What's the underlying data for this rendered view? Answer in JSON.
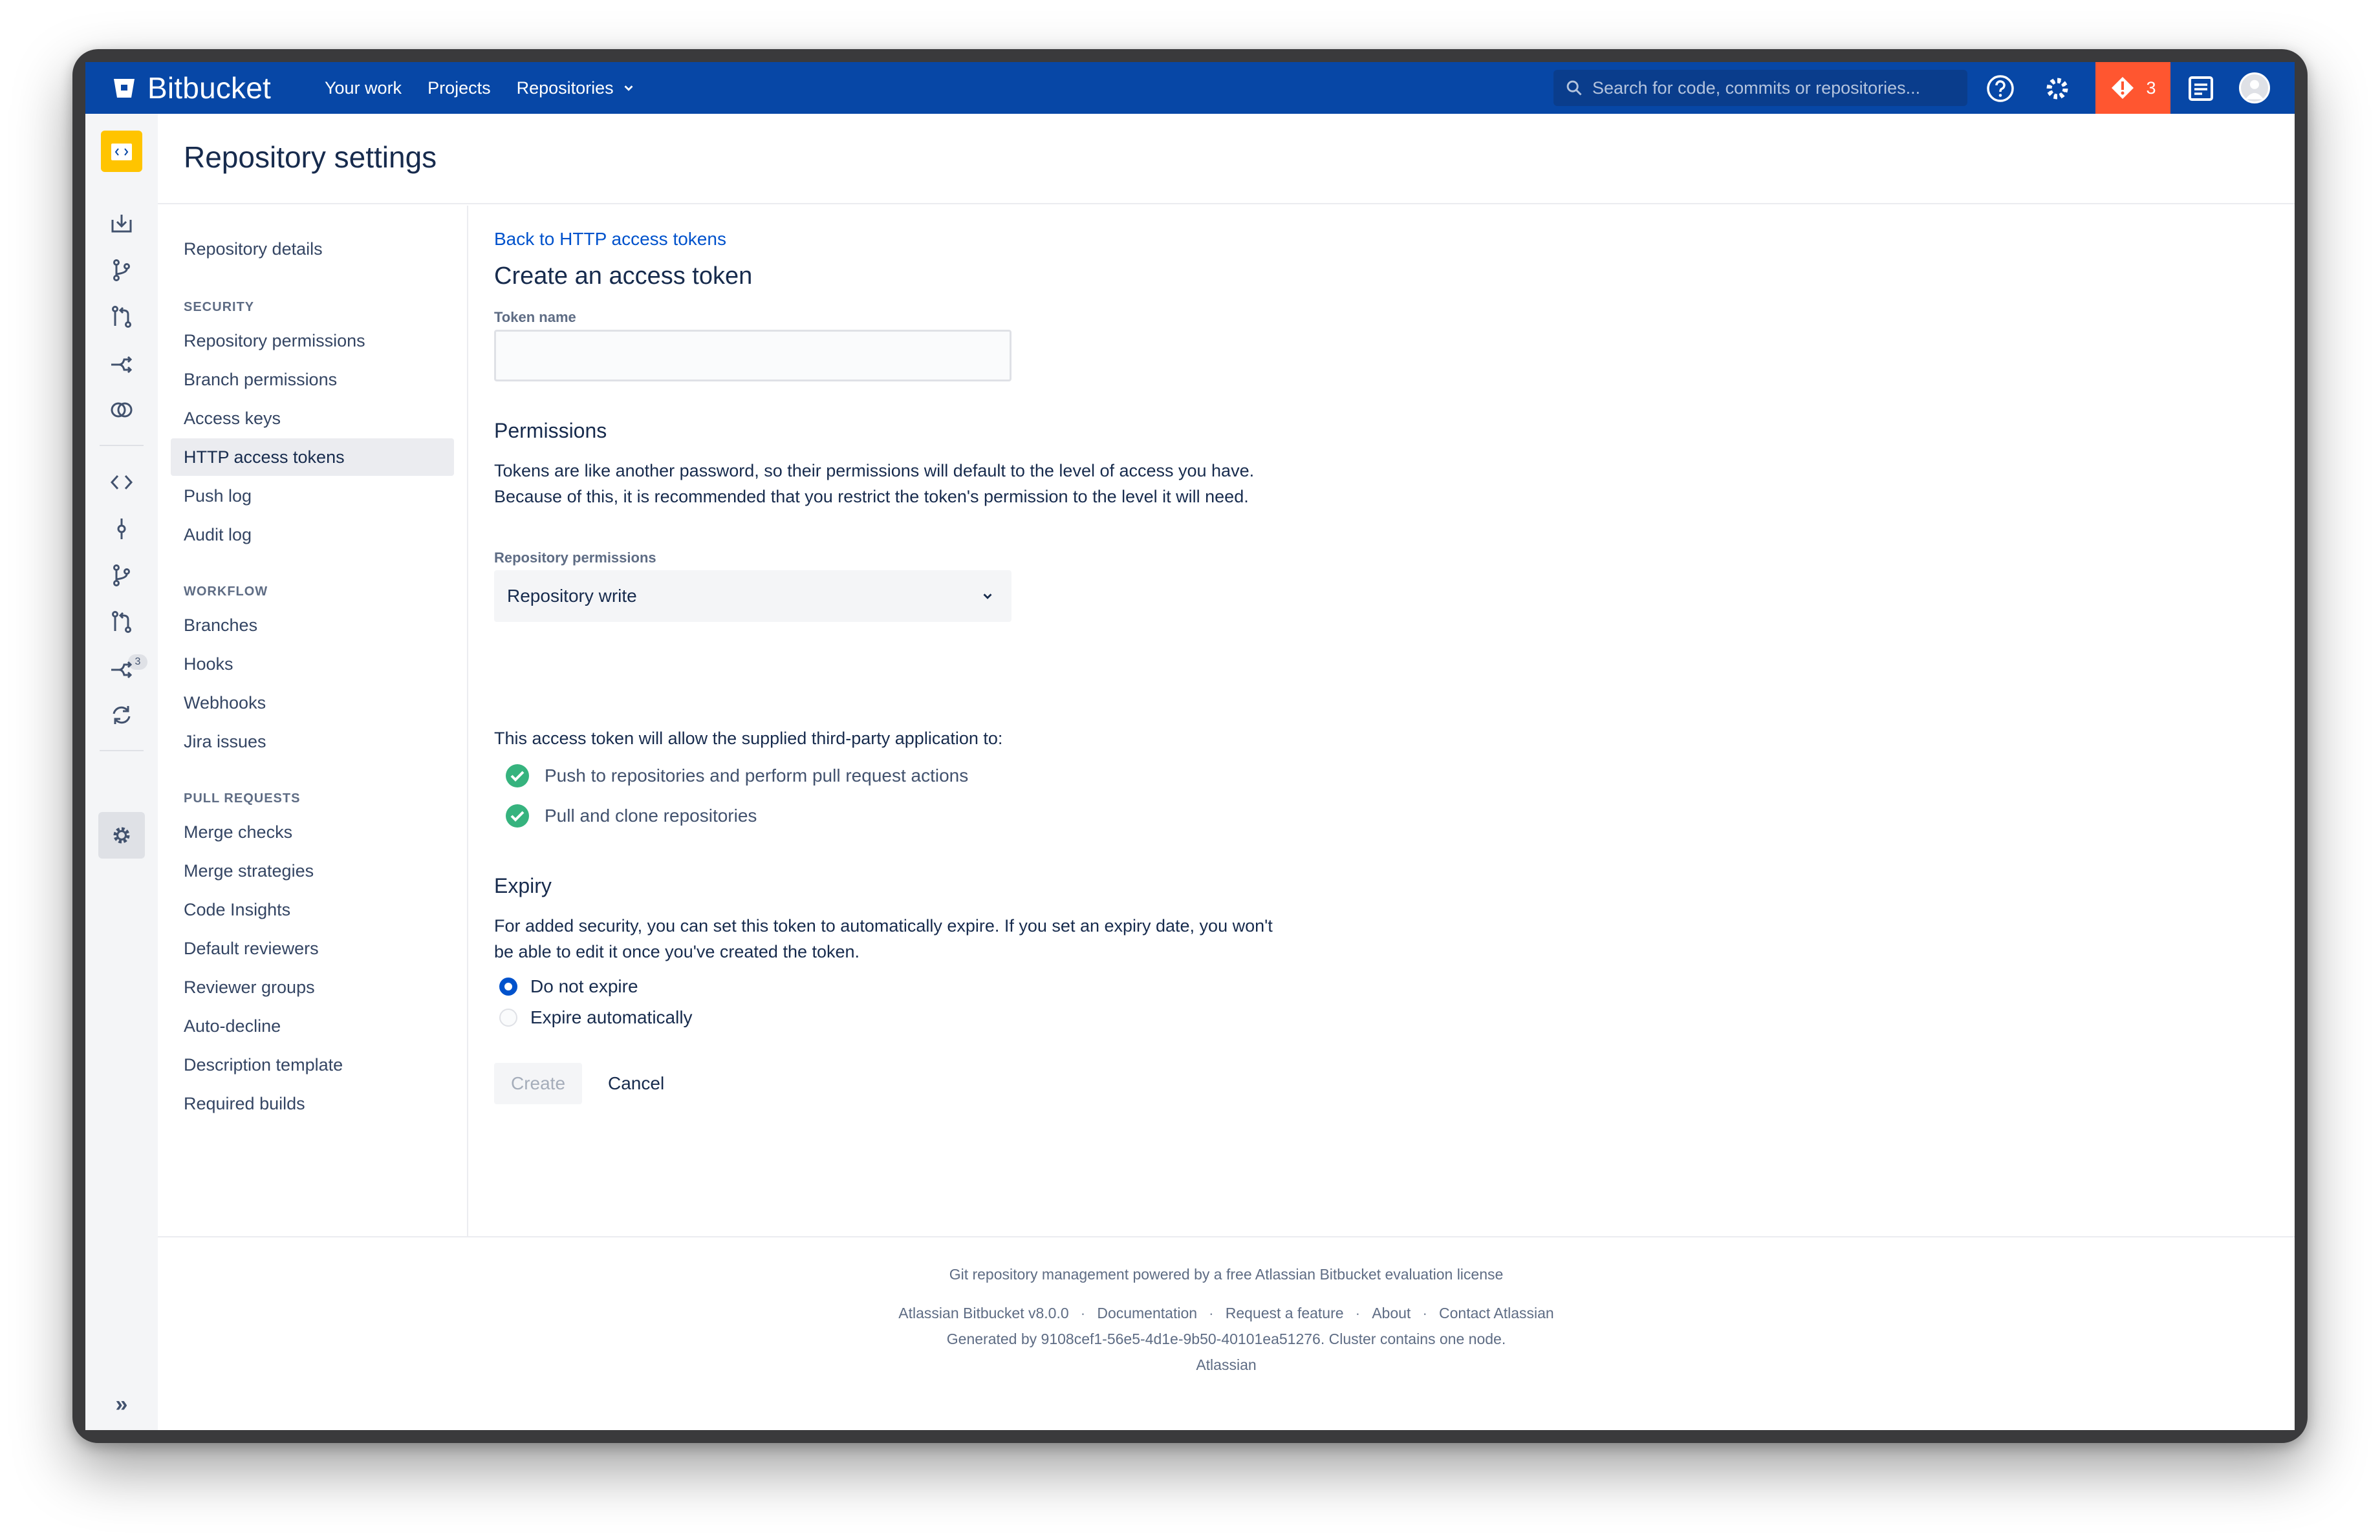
{
  "nav": {
    "brand": "Bitbucket",
    "items": [
      "Your work",
      "Projects",
      "Repositories"
    ],
    "search_placeholder": "Search for code, commits or repositories...",
    "alert_count": "3"
  },
  "rail": {
    "pr_badge": "3"
  },
  "header": {
    "title": "Repository settings"
  },
  "sidebar": {
    "top_item": "Repository details",
    "security_head": "SECURITY",
    "security": [
      "Repository permissions",
      "Branch permissions",
      "Access keys",
      "HTTP access tokens",
      "Push log",
      "Audit log"
    ],
    "workflow_head": "WORKFLOW",
    "workflow": [
      "Branches",
      "Hooks",
      "Webhooks",
      "Jira issues"
    ],
    "pr_head": "PULL REQUESTS",
    "pull_requests": [
      "Merge checks",
      "Merge strategies",
      "Code Insights",
      "Default reviewers",
      "Reviewer groups",
      "Auto-decline",
      "Description template",
      "Required builds"
    ]
  },
  "form": {
    "back_link": "Back to HTTP access tokens",
    "title": "Create an access token",
    "token_name_label": "Token name",
    "token_name_value": "",
    "permissions_title": "Permissions",
    "permissions_text": "Tokens are like another password, so their permissions will default to the level of access you have. Because of this, it is recommended that you restrict the token's permission to the level it will need.",
    "repo_perm_label": "Repository permissions",
    "repo_perm_value": "Repository write",
    "allow_text": "This access token will allow the supplied third-party application to:",
    "allow_items": [
      "Push to repositories and perform pull request actions",
      "Pull and clone repositories"
    ],
    "expiry_title": "Expiry",
    "expiry_text": "For added security, you can set this token to automatically expire. If you set an expiry date, you won't be able to edit it once you've created the token.",
    "expiry_options": [
      "Do not expire",
      "Expire automatically"
    ],
    "expiry_selected": "Do not expire",
    "create_label": "Create",
    "cancel_label": "Cancel"
  },
  "footer": {
    "license": "Git repository management powered by a free Atlassian Bitbucket evaluation license",
    "links": [
      "Atlassian Bitbucket v8.0.0",
      "Documentation",
      "Request a feature",
      "About",
      "Contact Atlassian"
    ],
    "separator": "·",
    "generated": "Generated by 9108cef1-56e5-4d1e-9b50-40101ea51276. Cluster contains one node.",
    "company": "Atlassian"
  },
  "colors": {
    "nav": "#0747a6",
    "alert": "#ff5630",
    "link": "#0052cc",
    "success": "#36b37e",
    "repo_avatar": "#ffc400"
  }
}
